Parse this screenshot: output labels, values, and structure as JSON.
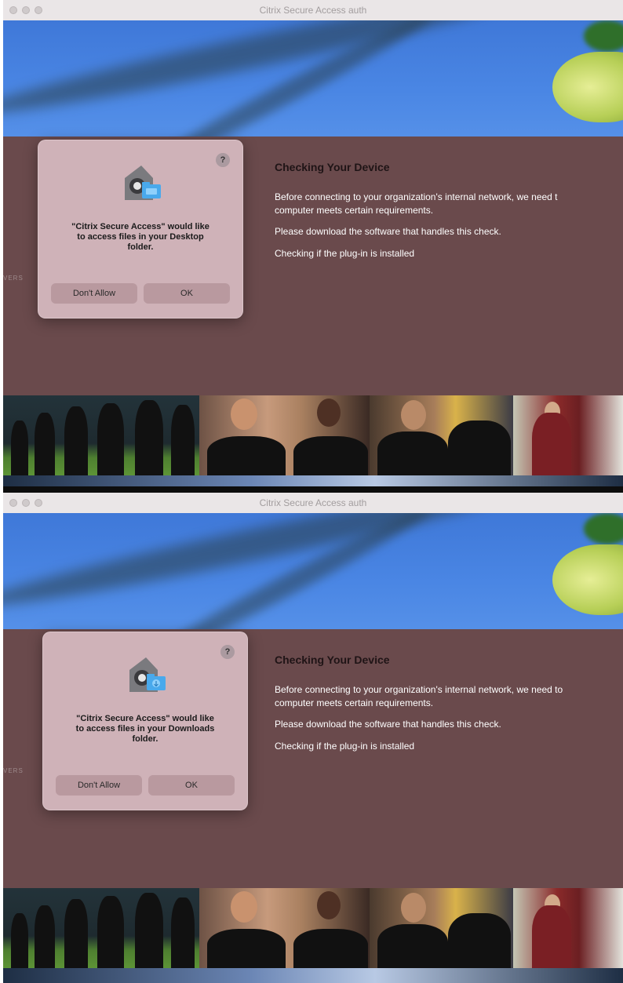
{
  "windows": [
    {
      "title": "Citrix Secure Access auth",
      "heading": "Checking Your Device",
      "paragraph1_line1": "Before connecting to your organization's internal network, we need t",
      "paragraph1_line2": "computer meets certain requirements.",
      "paragraph2": "Please download the software that handles this check.",
      "status": "Checking if the plug-in is installed",
      "background_watermark": "VERS",
      "dialog": {
        "help": "?",
        "message_line1": "\"Citrix Secure Access\" would like",
        "message_line2": "to access files in your Desktop",
        "message_line3": "folder.",
        "deny_label": "Don't Allow",
        "ok_label": "OK"
      }
    },
    {
      "title": "Citrix Secure Access auth",
      "heading": "Checking Your Device",
      "paragraph1_line1": "Before connecting to your organization's internal network, we need to",
      "paragraph1_line2": "computer meets certain requirements.",
      "paragraph2": "Please download the software that handles this check.",
      "status": "Checking if the plug-in is installed",
      "background_watermark": "VERS",
      "dialog": {
        "help": "?",
        "message_line1": "\"Citrix Secure Access\" would like",
        "message_line2": "to access files in your Downloads",
        "message_line3": "folder.",
        "deny_label": "Don't Allow",
        "ok_label": "OK"
      }
    }
  ],
  "icons": {
    "window_controls": [
      "close-dot-icon",
      "minimize-dot-icon",
      "zoom-dot-icon"
    ],
    "dialog_app_icon": "privacy-lock-folder-icon"
  },
  "colors": {
    "titlebar": "#eae6e7",
    "page_background": "#6a4a4c",
    "dialog_background": "#cfb2b8",
    "button_background": "#b9999f",
    "heading_text": "#1f1416",
    "body_text": "#ffffff"
  }
}
